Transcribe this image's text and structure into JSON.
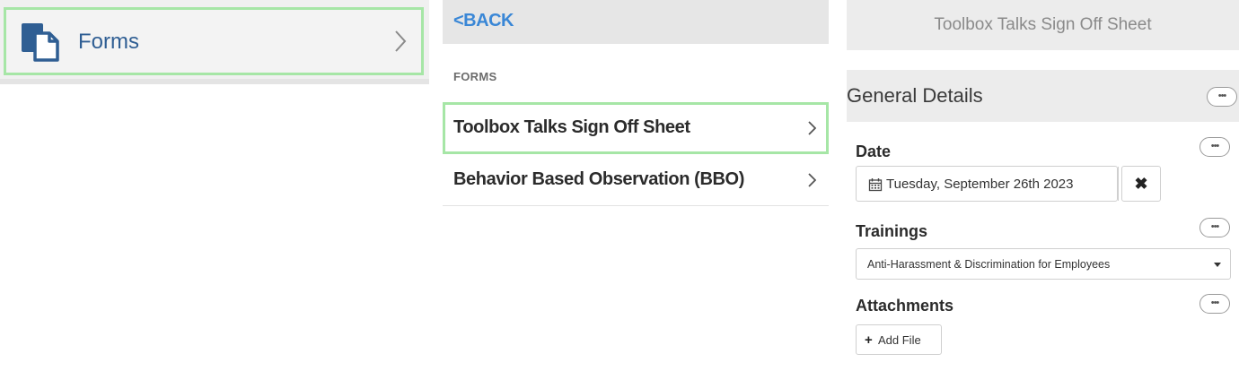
{
  "panel1": {
    "forms_label": "Forms",
    "forms_icon": "forms-document-icon",
    "chevron_icon": "chevron-right-icon",
    "accent": "#2f5e93",
    "highlight": "#a6e6a6"
  },
  "panel2": {
    "back_label": "<BACK",
    "section_header": "FORMS",
    "items": [
      {
        "label": "Toolbox Talks Sign Off Sheet",
        "highlighted": true
      },
      {
        "label": "Behavior Based Observation (BBO)",
        "highlighted": false
      }
    ],
    "back_color": "#3a87d6"
  },
  "panel3": {
    "title": "Toolbox Talks Sign Off Sheet",
    "section_title": "General Details",
    "more_label": "•••",
    "date": {
      "label": "Date",
      "value": "Tuesday, September 26th 2023",
      "clear_label": "✖",
      "icon": "calendar-icon"
    },
    "trainings": {
      "label": "Trainings",
      "selected": "Anti-Harassment & Discrimination for Employees",
      "icon": "caret-down-icon"
    },
    "attachments": {
      "label": "Attachments",
      "add_plus": "+",
      "add_label": "Add File"
    }
  }
}
